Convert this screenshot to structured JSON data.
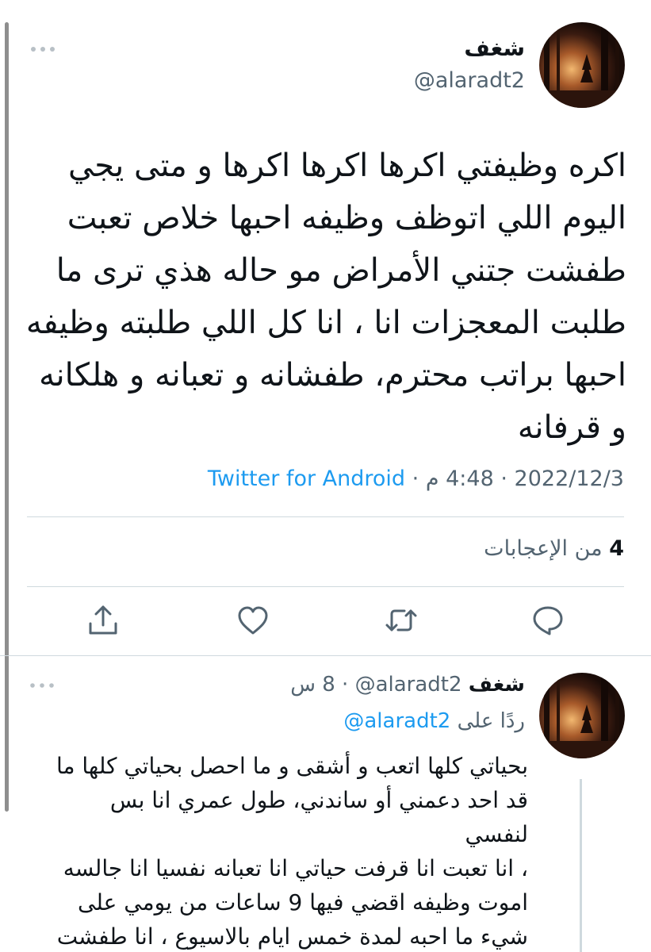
{
  "main_tweet": {
    "display_name": "شغف",
    "handle": "@alaradt2",
    "text": "اكره وظيفتي اكرها اكرها اكرها و متى يجي\nاليوم اللي اتوظف وظيفه احبها خلاص تعبت\nطفشت جتني الأمراض مو حاله هذي ترى ما\nطلبت المعجزات انا ، انا كل اللي طلبته وظيفه\nاحبها براتب محترم،  طفشانه و تعبانه و هلكانه\nو قرفانه",
    "date": "2022/12/3",
    "time": "4:48 م",
    "separator": "·",
    "source": "Twitter for Android",
    "likes_count": "4",
    "likes_label": "من الإعجابات"
  },
  "actions": {
    "reply": "reply-icon",
    "retweet": "retweet-icon",
    "like": "like-icon",
    "share": "share-icon"
  },
  "reply_tweet": {
    "display_name": "شغف",
    "handle": "@alaradt2",
    "separator": "·",
    "time": "8 س",
    "replying_to_label": "ردًا على",
    "replying_to_handle": "@alaradt2",
    "text": "بحياتي كلها اتعب و أشقى و ما احصل بحياتي كلها ما\nقد احد دعمني أو ساندني،  طول عمري انا بس لنفسي\n، انا تعبت انا قرفت حياتي انا تعبانه نفسيا انا جالسه\nاموت وظيفه اقضي فيها 9 ساعات من يومي على\nشيء ما احبه لمدة خمس ايام بالاسيوع ، انا طفشت\nخلاص"
  },
  "colors": {
    "accent": "#1d9bf0",
    "secondary_text": "#536471",
    "divider": "#cfd9de"
  }
}
